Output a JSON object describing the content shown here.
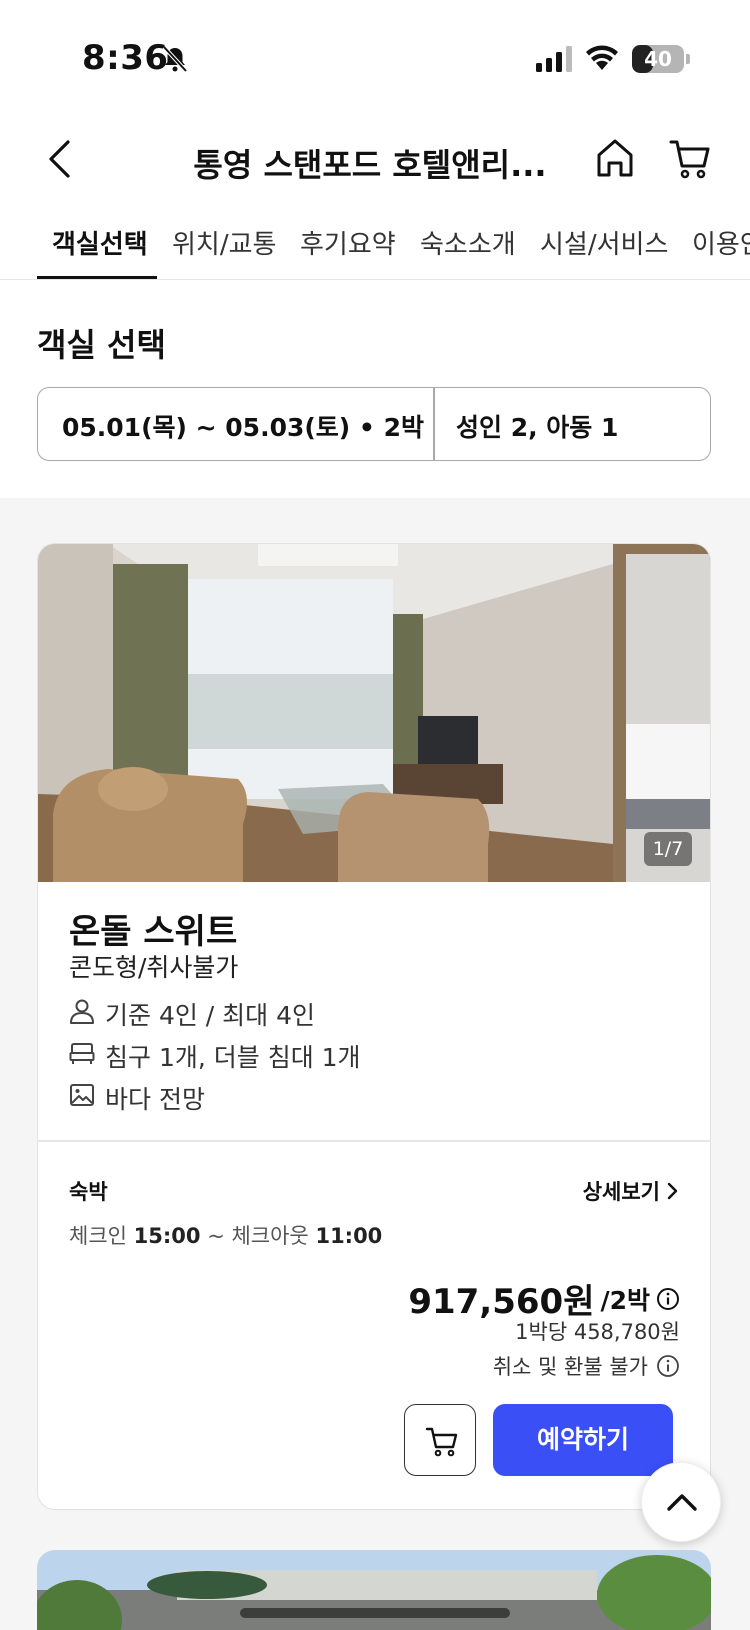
{
  "status_bar": {
    "time": "8:36",
    "battery": "40"
  },
  "header": {
    "title": "통영 스탠포드 호텔앤리..."
  },
  "tabs": [
    {
      "label": "객실선택"
    },
    {
      "label": "위치/교통"
    },
    {
      "label": "후기요약"
    },
    {
      "label": "숙소소개"
    },
    {
      "label": "시설/서비스"
    },
    {
      "label": "이용안내"
    }
  ],
  "section": {
    "title": "객실 선택",
    "date_range": "05.01(목) ~ 05.03(토) • 2박",
    "guests": "성인 2, 아동 1"
  },
  "room": {
    "photo_counter": "1/7",
    "name": "온돌 스위트",
    "type": "콘도형/취사불가",
    "capacity": "기준 4인 / 최대 4인",
    "beds": "침구 1개, 더블 침대 1개",
    "view": "바다 전망",
    "stay_label": "숙박",
    "detail_link": "상세보기",
    "checkin_label": "체크인",
    "checkin_time": "15:00",
    "checkout_label": "~ 체크아웃",
    "checkout_time": "11:00",
    "price": "917,560원",
    "price_unit": "/2박",
    "per_night": "1박당 458,780원",
    "cancel_policy": "취소 및 환불 불가",
    "book_label": "예약하기"
  },
  "colors": {
    "accent": "#3a4ff5"
  }
}
